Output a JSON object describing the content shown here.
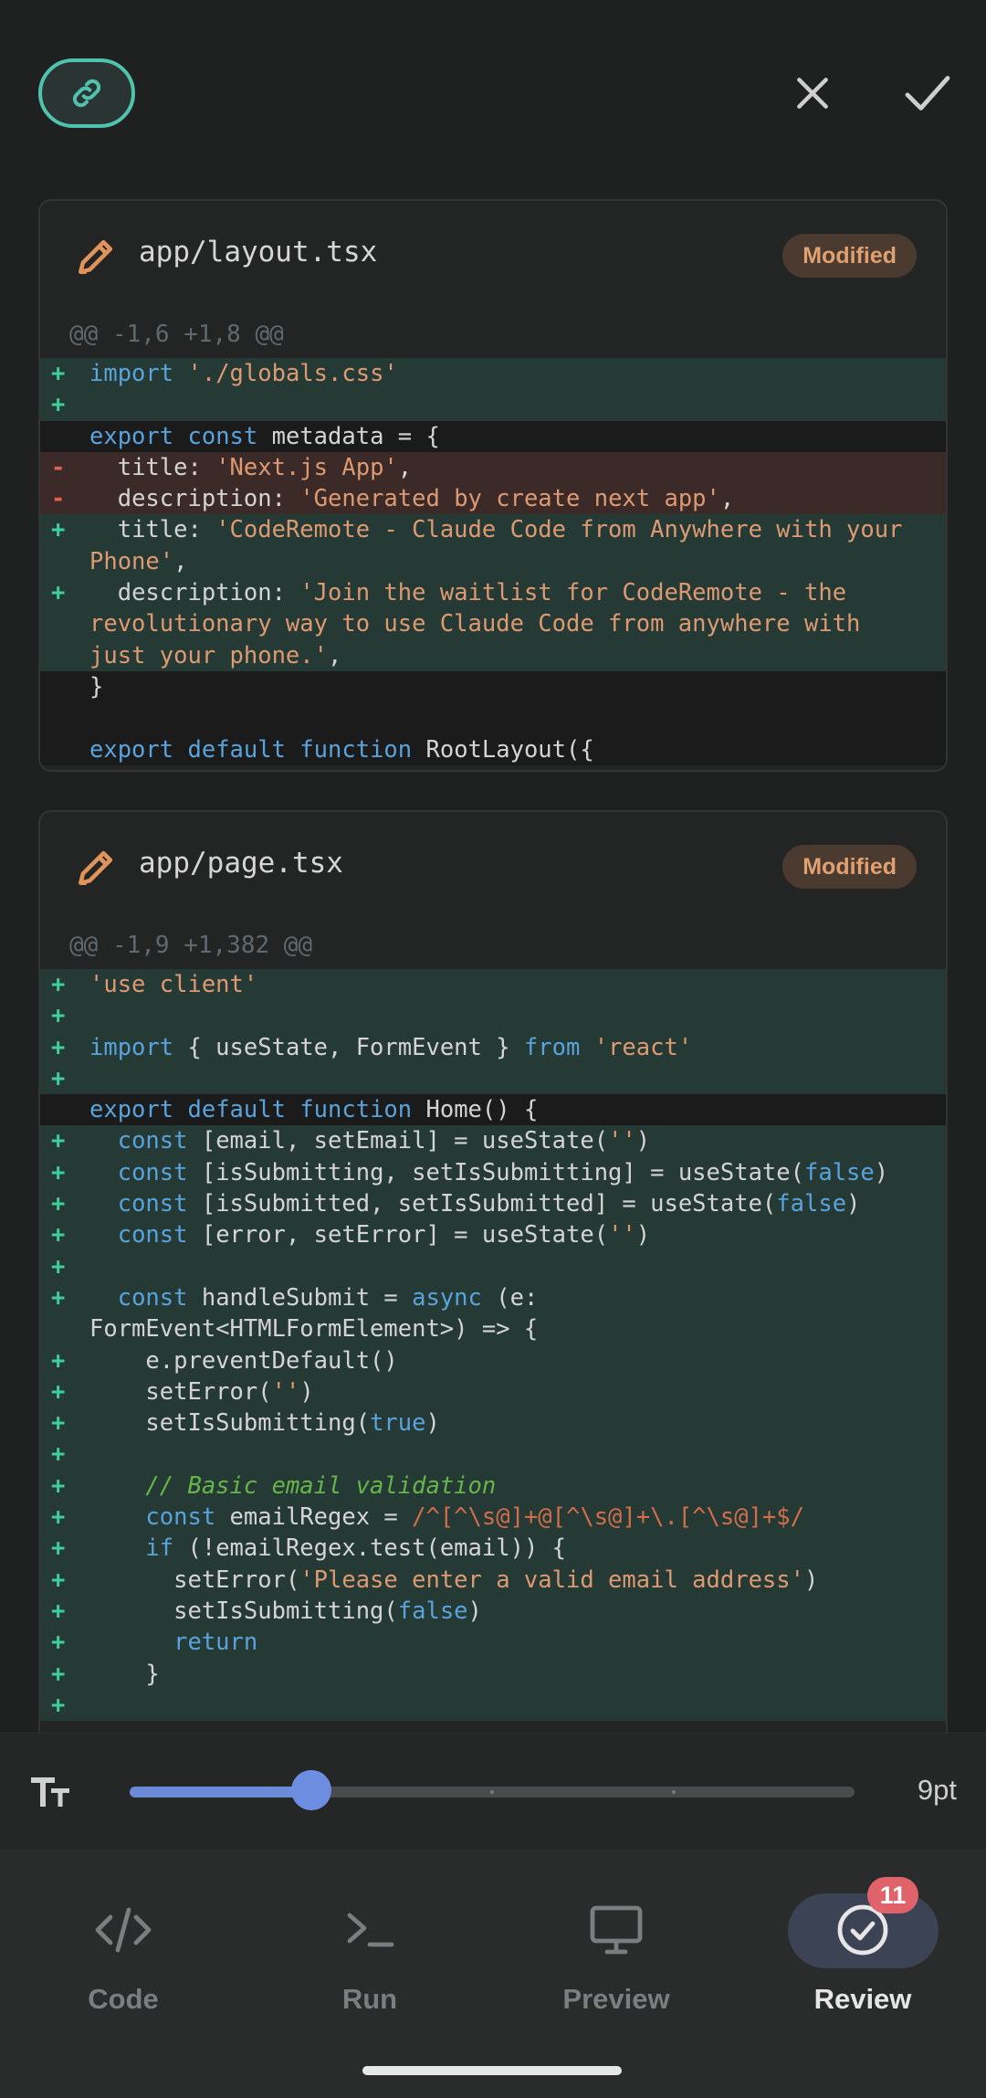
{
  "topbar": {
    "link_icon": "link-icon",
    "close_icon": "close-icon",
    "confirm_icon": "check-icon"
  },
  "colors": {
    "accent": "#4fc3ad",
    "added_bg": "#263a35",
    "removed_bg": "#3b2a28",
    "badge_bg": "#4a3a30",
    "badge_text": "#e0a070",
    "slider": "#6b8bd8",
    "notification": "#e0626a"
  },
  "files": [
    {
      "name": "app/layout.tsx",
      "status": "Modified",
      "hunk": "@@ -1,6 +1,8 @@",
      "lines": [
        {
          "type": "add",
          "marker": "+",
          "text": "import './globals.css'"
        },
        {
          "type": "add",
          "marker": "+",
          "text": ""
        },
        {
          "type": "ctx",
          "marker": "",
          "text": "export const metadata = {"
        },
        {
          "type": "del",
          "marker": "-",
          "text": "  title: 'Next.js App',"
        },
        {
          "type": "del",
          "marker": "-",
          "text": "  description: 'Generated by create next app',"
        },
        {
          "type": "add",
          "marker": "+",
          "text": "  title: 'CodeRemote - Claude Code from Anywhere with your Phone',"
        },
        {
          "type": "add",
          "marker": "+",
          "text": "  description: 'Join the waitlist for CodeRemote - the revolutionary way to use Claude Code from anywhere with just your phone.',"
        },
        {
          "type": "ctx",
          "marker": "",
          "text": "}"
        },
        {
          "type": "ctx",
          "marker": "",
          "text": ""
        },
        {
          "type": "ctx",
          "marker": "",
          "text": "export default function RootLayout({"
        }
      ]
    },
    {
      "name": "app/page.tsx",
      "status": "Modified",
      "hunk": "@@ -1,9 +1,382 @@",
      "lines": [
        {
          "type": "add",
          "marker": "+",
          "text": "'use client'"
        },
        {
          "type": "add",
          "marker": "+",
          "text": ""
        },
        {
          "type": "add",
          "marker": "+",
          "text": "import { useState, FormEvent } from 'react'"
        },
        {
          "type": "add",
          "marker": "+",
          "text": ""
        },
        {
          "type": "ctx",
          "marker": "",
          "text": "export default function Home() {"
        },
        {
          "type": "add",
          "marker": "+",
          "text": "  const [email, setEmail] = useState('')"
        },
        {
          "type": "add",
          "marker": "+",
          "text": "  const [isSubmitting, setIsSubmitting] = useState(false)"
        },
        {
          "type": "add",
          "marker": "+",
          "text": "  const [isSubmitted, setIsSubmitted] = useState(false)"
        },
        {
          "type": "add",
          "marker": "+",
          "text": "  const [error, setError] = useState('')"
        },
        {
          "type": "add",
          "marker": "+",
          "text": ""
        },
        {
          "type": "add",
          "marker": "+",
          "text": "  const handleSubmit = async (e: FormEvent<HTMLFormElement>) => {"
        },
        {
          "type": "add",
          "marker": "+",
          "text": "    e.preventDefault()"
        },
        {
          "type": "add",
          "marker": "+",
          "text": "    setError('')"
        },
        {
          "type": "add",
          "marker": "+",
          "text": "    setIsSubmitting(true)"
        },
        {
          "type": "add",
          "marker": "+",
          "text": ""
        },
        {
          "type": "add",
          "marker": "+",
          "text": "    // Basic email validation"
        },
        {
          "type": "add",
          "marker": "+",
          "text": "    const emailRegex = /^[^\\s@]+@[^\\s@]+\\.[^\\s@]+$/"
        },
        {
          "type": "add",
          "marker": "+",
          "text": "    if (!emailRegex.test(email)) {"
        },
        {
          "type": "add",
          "marker": "+",
          "text": "      setError('Please enter a valid email address')"
        },
        {
          "type": "add",
          "marker": "+",
          "text": "      setIsSubmitting(false)"
        },
        {
          "type": "add",
          "marker": "+",
          "text": "      return"
        },
        {
          "type": "add",
          "marker": "+",
          "text": "    }"
        },
        {
          "type": "add",
          "marker": "+",
          "text": ""
        }
      ]
    }
  ],
  "font_size": {
    "icon": "text-size-icon",
    "label": "9pt",
    "level": 0.25,
    "steps": 5
  },
  "tabs": [
    {
      "label": "Code",
      "icon": "code-icon",
      "active": false
    },
    {
      "label": "Run",
      "icon": "terminal-icon",
      "active": false
    },
    {
      "label": "Preview",
      "icon": "monitor-icon",
      "active": false
    },
    {
      "label": "Review",
      "icon": "check-circle-icon",
      "active": true,
      "badge": "11"
    }
  ]
}
